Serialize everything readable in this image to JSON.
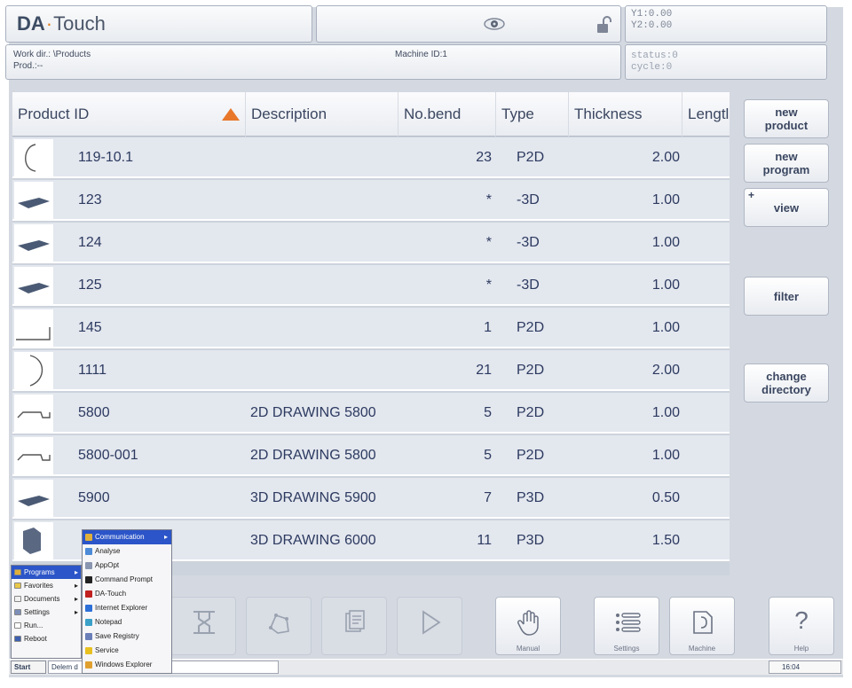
{
  "header": {
    "logo_brand": "DA",
    "logo_sep": "·",
    "logo_touch": "Touch",
    "coord_y1": "Y1:0.00",
    "coord_y2": "Y2:0.00",
    "work_dir": "Work dir.: \\Products",
    "prod": "Prod.:--",
    "machine_id": "Machine ID:1",
    "status": "status:0",
    "cycle": "cycle:0"
  },
  "table": {
    "columns": [
      "Product ID",
      "Description",
      "No.bend",
      "Type",
      "Thickness",
      "Lengtl"
    ],
    "sort_column": "Product ID",
    "rows": [
      {
        "id": "119-10.1",
        "desc": "",
        "bends": "23",
        "type": "P2D",
        "thickness": "2.00",
        "thumb": "arc-profile"
      },
      {
        "id": "123",
        "desc": "",
        "bends": "*",
        "type": "-3D",
        "thickness": "1.00",
        "thumb": "plate-3d"
      },
      {
        "id": "124",
        "desc": "",
        "bends": "*",
        "type": "-3D",
        "thickness": "1.00",
        "thumb": "plate-3d"
      },
      {
        "id": "125",
        "desc": "",
        "bends": "*",
        "type": "-3D",
        "thickness": "1.00",
        "thumb": "plate-3d"
      },
      {
        "id": "145",
        "desc": "",
        "bends": "1",
        "type": "P2D",
        "thickness": "1.00",
        "thumb": "l-profile"
      },
      {
        "id": "1111",
        "desc": "",
        "bends": "21",
        "type": "P2D",
        "thickness": "2.00",
        "thumb": "half-arc"
      },
      {
        "id": "5800",
        "desc": "2D DRAWING 5800",
        "bends": "5",
        "type": "P2D",
        "thickness": "1.00",
        "thumb": "hat-profile"
      },
      {
        "id": "5800-001",
        "desc": "2D DRAWING 5800",
        "bends": "5",
        "type": "P2D",
        "thickness": "1.00",
        "thumb": "hat-profile"
      },
      {
        "id": "5900",
        "desc": "3D DRAWING 5900",
        "bends": "7",
        "type": "P3D",
        "thickness": "0.50",
        "thumb": "plate-3d"
      },
      {
        "id": "",
        "desc": "3D DRAWING 6000",
        "bends": "11",
        "type": "P3D",
        "thickness": "1.50",
        "thumb": "box-3d"
      }
    ]
  },
  "side_buttons": [
    {
      "label": "new\nproduct"
    },
    {
      "label": "new\nprogram"
    },
    {
      "label": "view"
    },
    {
      "label": "filter"
    },
    {
      "label": "change\ndirectory"
    }
  ],
  "bottom_buttons": [
    "Manual",
    "Settings",
    "Machine",
    "Help"
  ],
  "help_glyph": "?",
  "taskbar": {
    "start": "Start",
    "task": "Delem d",
    "time": "16:04"
  },
  "start_menu": [
    "Programs",
    "Favorites",
    "Documents",
    "Settings",
    "Run...",
    "Reboot"
  ],
  "programs_menu": [
    "Communication",
    "Analyse",
    "AppOpt",
    "Command Prompt",
    "DA-Touch",
    "Internet Explorer",
    "Notepad",
    "Save Registry",
    "Service",
    "Windows Explorer"
  ],
  "colors": {
    "sort_arrow": "#e8772a",
    "menu_highlight": "#2b55c8",
    "row_text": "#2c3a60"
  }
}
